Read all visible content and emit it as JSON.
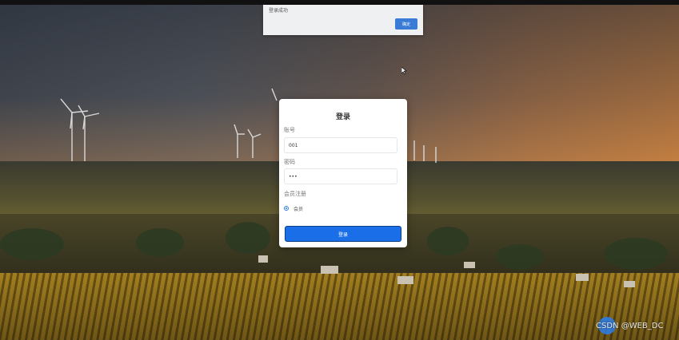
{
  "alert": {
    "message": "登录成功",
    "ok_label": "确定"
  },
  "login": {
    "title": "登录",
    "account_label": "账号",
    "account_value": "001",
    "password_label": "密码",
    "password_mask": "•••",
    "role_label": "会员注册",
    "role_option": "会员",
    "submit_label": "登录"
  },
  "watermark": "CSDN @WEB_DC",
  "colors": {
    "primary_button": "#1a6fe8",
    "alert_button": "#3a7bd5"
  }
}
